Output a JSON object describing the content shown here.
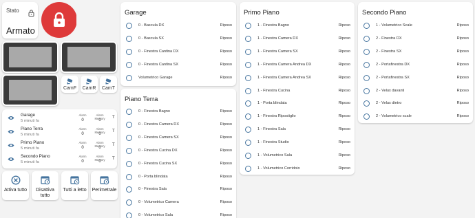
{
  "status": {
    "label": "Stato",
    "value": "Armato",
    "lock_color": "#de3a3a"
  },
  "cameras": {
    "buttons": [
      "CamF",
      "CamR",
      "CamT"
    ]
  },
  "zones": {
    "alarm_header": "Alarm",
    "memory_header": "Alarm Memory",
    "items": [
      {
        "name": "Garage",
        "time": "5 minuti fa",
        "alarm": "0",
        "memory": "0",
        "t": "T"
      },
      {
        "name": "Piano Terra",
        "time": "5 minuti fa",
        "alarm": "0",
        "memory": "0",
        "t": "T"
      },
      {
        "name": "Primo Piano",
        "time": "5 minuti fa",
        "alarm": "0",
        "memory": "0",
        "t": "T"
      },
      {
        "name": "Secondo Piano",
        "time": "5 minuti fa",
        "alarm": "0",
        "memory": "0",
        "t": "T"
      }
    ]
  },
  "actions": [
    {
      "label": "Attiva tutto",
      "icon": "close-circle-icon"
    },
    {
      "label": "Disattiva tutto",
      "icon": "calendar-clock-icon"
    },
    {
      "label": "Tutti a letto",
      "icon": "calendar-clock-icon"
    },
    {
      "label": "Perimetrale",
      "icon": "calendar-clock-icon"
    }
  ],
  "accent": "#44739e",
  "columns": [
    {
      "title": "Garage",
      "sensors": [
        {
          "name": "0 - Bascula DX",
          "state": "Riposo"
        },
        {
          "name": "0 - Bascula SX",
          "state": "Riposo"
        },
        {
          "name": "0 - Finestra Cantina DX",
          "state": "Riposo"
        },
        {
          "name": "0 - Finestra Cantina SX",
          "state": "Riposo"
        },
        {
          "name": "Volumetrico Garage",
          "state": "Riposo"
        }
      ]
    },
    {
      "title": "Piano Terra",
      "sensors": [
        {
          "name": "0 - Finestra Bagno",
          "state": "Riposo"
        },
        {
          "name": "0 - Finestra Camera DX",
          "state": "Riposo"
        },
        {
          "name": "0 - Finestra Camera SX",
          "state": "Riposo"
        },
        {
          "name": "0 - Finestra Cucina DX",
          "state": "Riposo"
        },
        {
          "name": "0 - Finestra Cucina SX",
          "state": "Riposo"
        },
        {
          "name": "0 - Porta blindata",
          "state": "Riposo"
        },
        {
          "name": "0 - Finestra Sala",
          "state": "Riposo"
        },
        {
          "name": "0 - Volumetrico Camera",
          "state": "Riposo"
        },
        {
          "name": "0 - Volumetrico Sala",
          "state": "Riposo"
        }
      ]
    },
    {
      "title": "Primo Piano",
      "sensors": [
        {
          "name": "1 - Finestra Bagno",
          "state": "Riposo"
        },
        {
          "name": "1 - Finestra Camera DX",
          "state": "Riposo"
        },
        {
          "name": "1 - Finestra Camera SX",
          "state": "Riposo"
        },
        {
          "name": "1 - Finestra Camera Andrea DX",
          "state": "Riposo"
        },
        {
          "name": "1 - Finestra Camera Andrea SX",
          "state": "Riposo"
        },
        {
          "name": "1 - Finestra Cucina",
          "state": "Riposo"
        },
        {
          "name": "1 - Porta blindata",
          "state": "Riposo"
        },
        {
          "name": "1 - Finestra Ripostiglio",
          "state": "Riposo"
        },
        {
          "name": "1 - Finestra Sala",
          "state": "Riposo"
        },
        {
          "name": "1 - Finestra Studio",
          "state": "Riposo"
        },
        {
          "name": "1 - Volumetrico Sala",
          "state": "Riposo"
        },
        {
          "name": "1 - Volumetrico Corridoio",
          "state": "Riposo"
        }
      ]
    },
    {
      "title": "Secondo Piano",
      "sensors": [
        {
          "name": "1 - Volumetrico Scale",
          "state": "Riposo"
        },
        {
          "name": "2 - Finestra DX",
          "state": "Riposo"
        },
        {
          "name": "2 - Finestra SX",
          "state": "Riposo"
        },
        {
          "name": "2 - Portafinestra DX",
          "state": "Riposo"
        },
        {
          "name": "2 - Portafinestra SX",
          "state": "Riposo"
        },
        {
          "name": "2 - Velux davanti",
          "state": "Riposo"
        },
        {
          "name": "2 - Velux dietro",
          "state": "Riposo"
        },
        {
          "name": "2 - Volumetrico scale",
          "state": "Riposo"
        }
      ]
    }
  ]
}
